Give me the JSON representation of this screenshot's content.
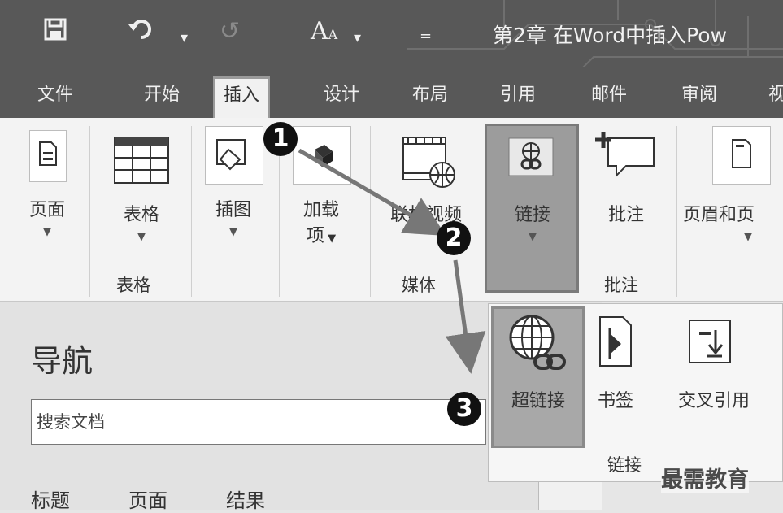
{
  "quick_access": {
    "font_btn": "A",
    "customize": "="
  },
  "title_bar": {
    "doc_title": "第2章 在Word中插入Pow"
  },
  "tabs": [
    "文件",
    "开始",
    "插入",
    "设计",
    "布局",
    "引用",
    "邮件",
    "审阅",
    "视"
  ],
  "active_tab": "插入",
  "ribbon": {
    "pages": {
      "label": "页面"
    },
    "table": {
      "label": "表格",
      "group": "表格"
    },
    "illustrations": {
      "label": "插图"
    },
    "addins": {
      "label_line1": "加载",
      "label_line2": "项"
    },
    "online_video": {
      "label": "联机视频"
    },
    "media_group": "媒体",
    "link": {
      "label": "链接"
    },
    "comment": {
      "label": "批注",
      "group": "批注"
    },
    "header_footer": {
      "label": "页眉和页"
    }
  },
  "link_dropdown": {
    "items": [
      {
        "label": "超链接",
        "icon": "hyperlink-globe-icon"
      },
      {
        "label": "书签",
        "icon": "bookmark-icon"
      },
      {
        "label": "交叉引用",
        "icon": "cross-reference-icon"
      }
    ],
    "group_label": "链接"
  },
  "navigation": {
    "title": "导航",
    "search_placeholder": "搜索文档",
    "tabs": [
      "标题",
      "页面",
      "结果"
    ]
  },
  "steps": [
    "1",
    "2",
    "3"
  ],
  "watermark": "最需教育"
}
